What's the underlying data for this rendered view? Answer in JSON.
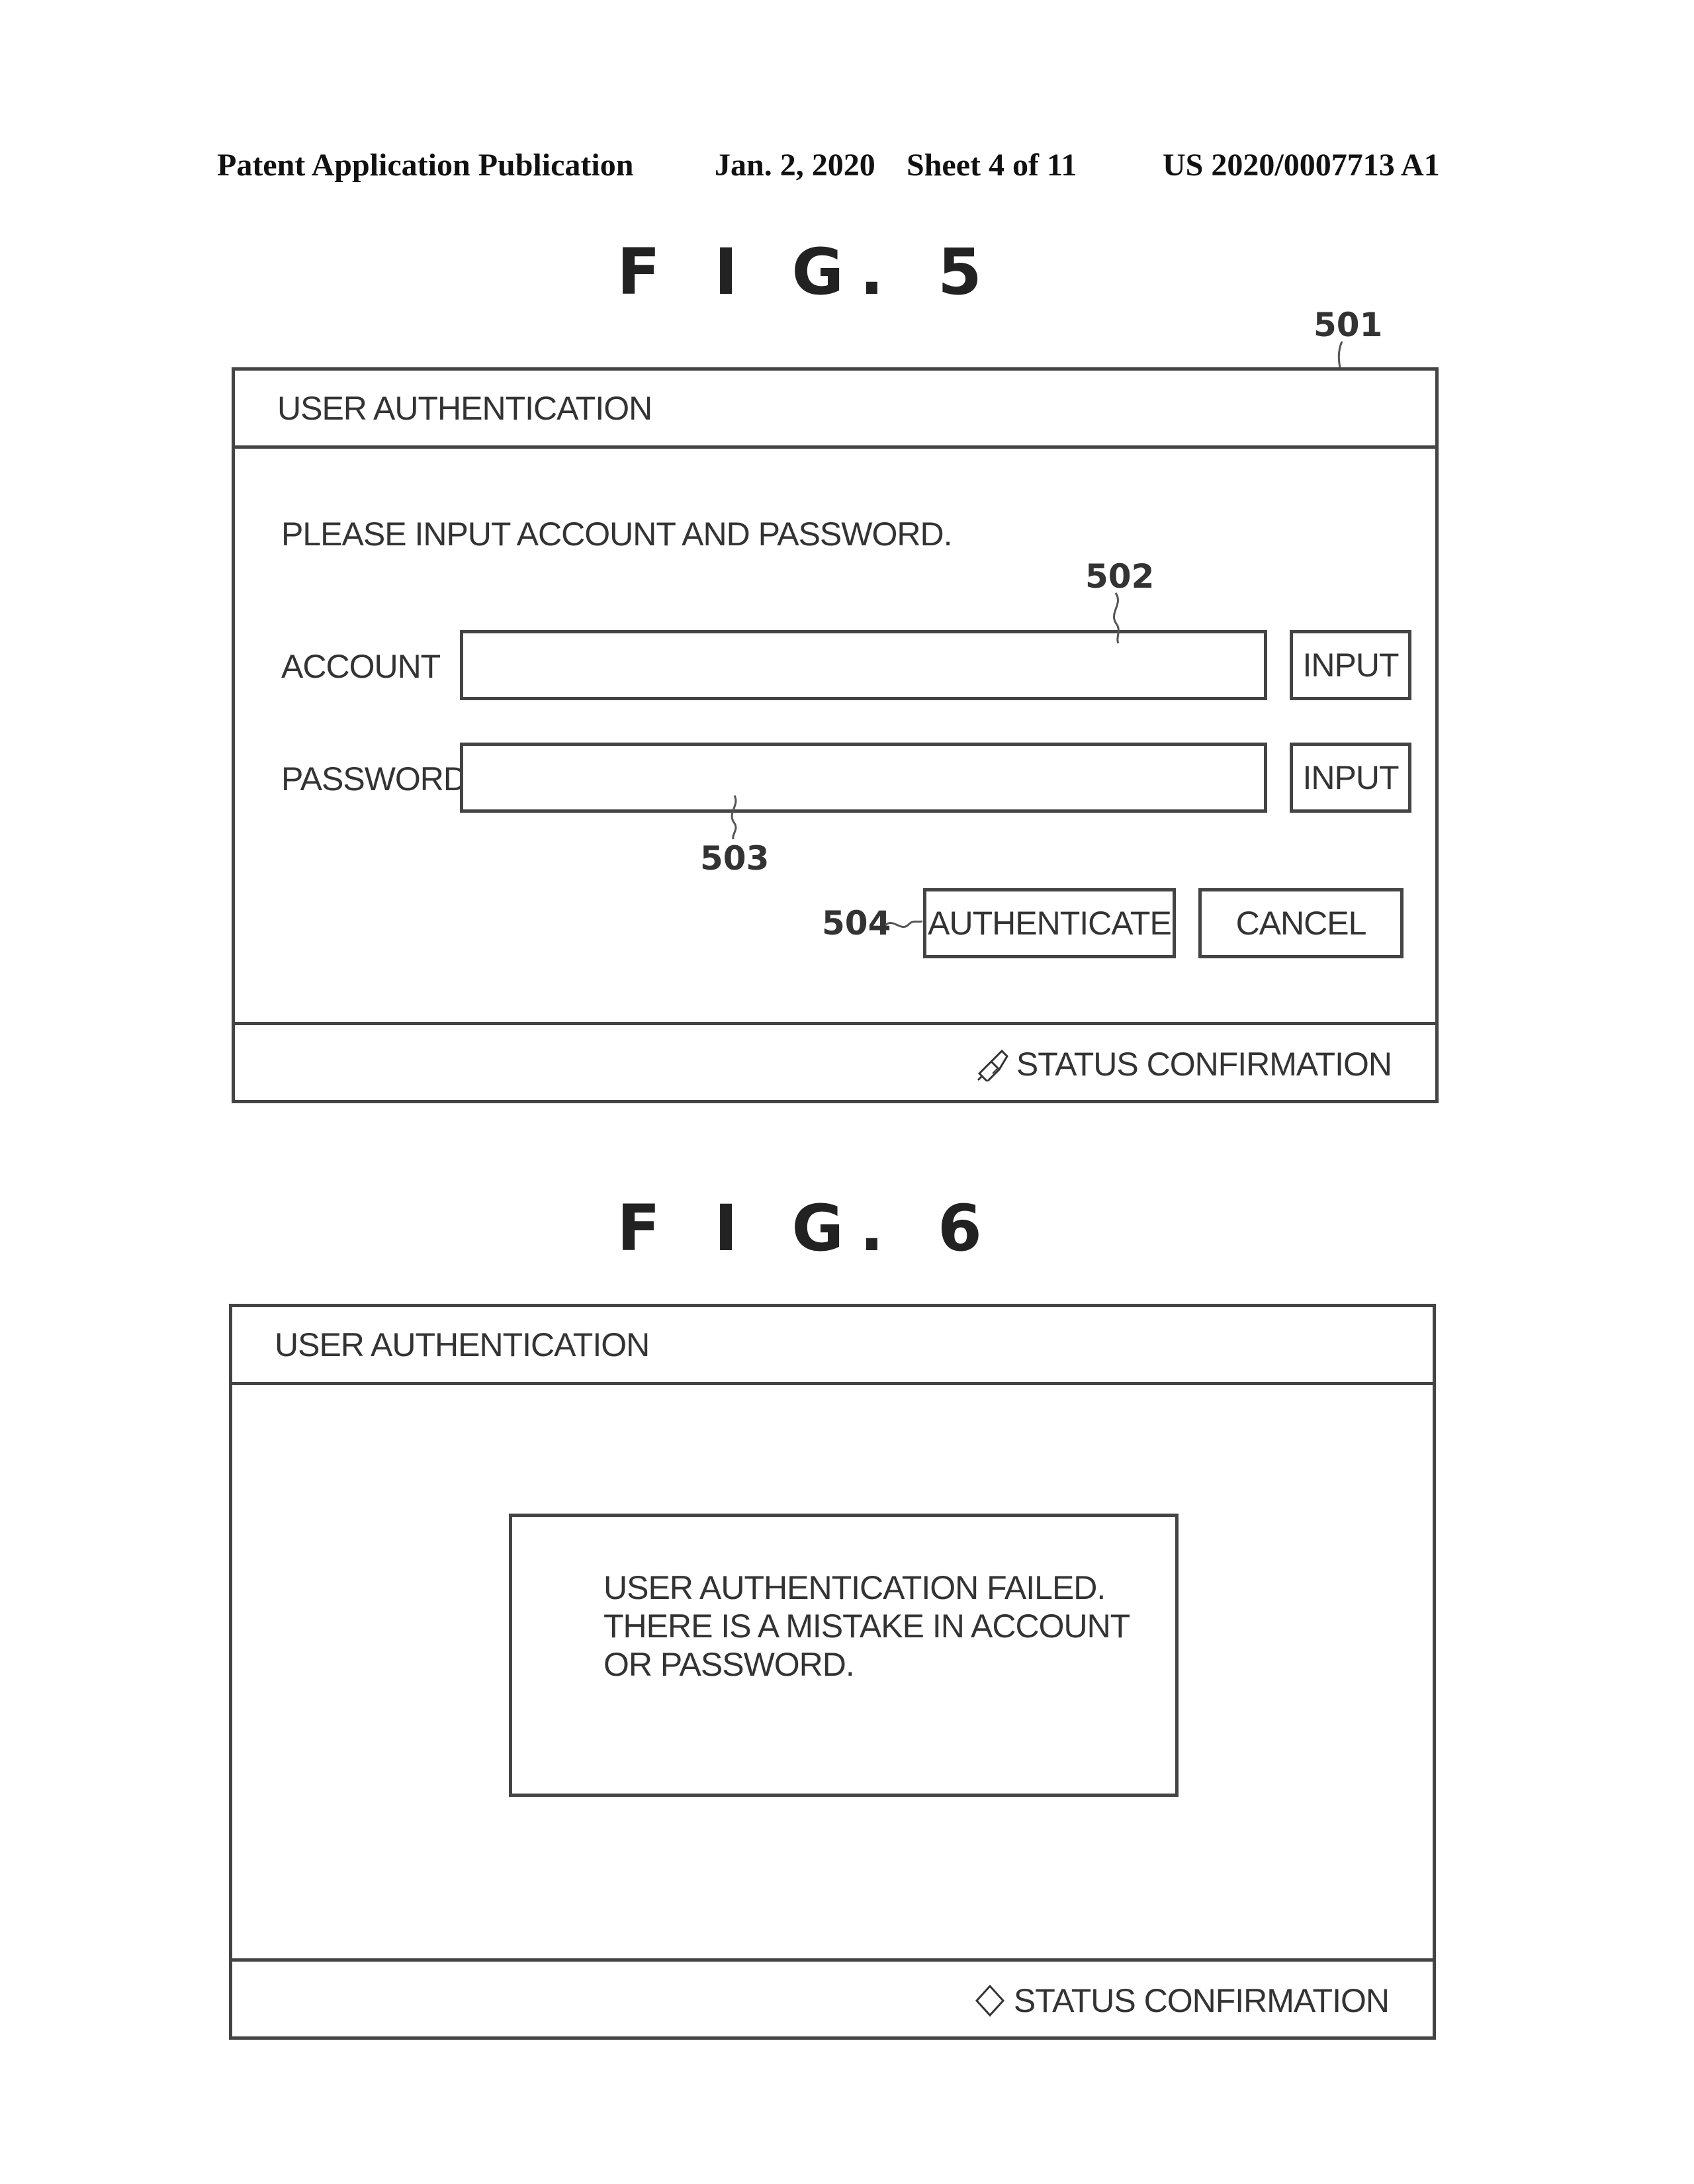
{
  "header": {
    "publication": "Patent Application Publication",
    "date": "Jan. 2, 2020",
    "sheet": "Sheet 4 of 11",
    "number": "US 2020/0007713 A1"
  },
  "fig5": {
    "title": "F I G. 5",
    "refs": {
      "screen": "501",
      "account_field": "502",
      "password_field": "503",
      "authenticate_button": "504"
    },
    "window_title": "USER AUTHENTICATION",
    "instruction": "PLEASE INPUT ACCOUNT AND PASSWORD.",
    "account_label": "ACCOUNT",
    "password_label": "PASSWORD",
    "account_value": "",
    "password_value": "",
    "input_button_label": "INPUT",
    "authenticate_label": "AUTHENTICATE",
    "cancel_label": "CANCEL",
    "status_label": "STATUS CONFIRMATION",
    "status_icon": "pencil-diamond-icon"
  },
  "fig6": {
    "title": "F I G. 6",
    "window_title": "USER AUTHENTICATION",
    "message_lines": [
      "USER AUTHENTICATION FAILED.",
      "THERE IS A MISTAKE IN ACCOUNT",
      "OR PASSWORD."
    ],
    "status_label": "STATUS CONFIRMATION",
    "status_icon": "diamond-icon"
  }
}
